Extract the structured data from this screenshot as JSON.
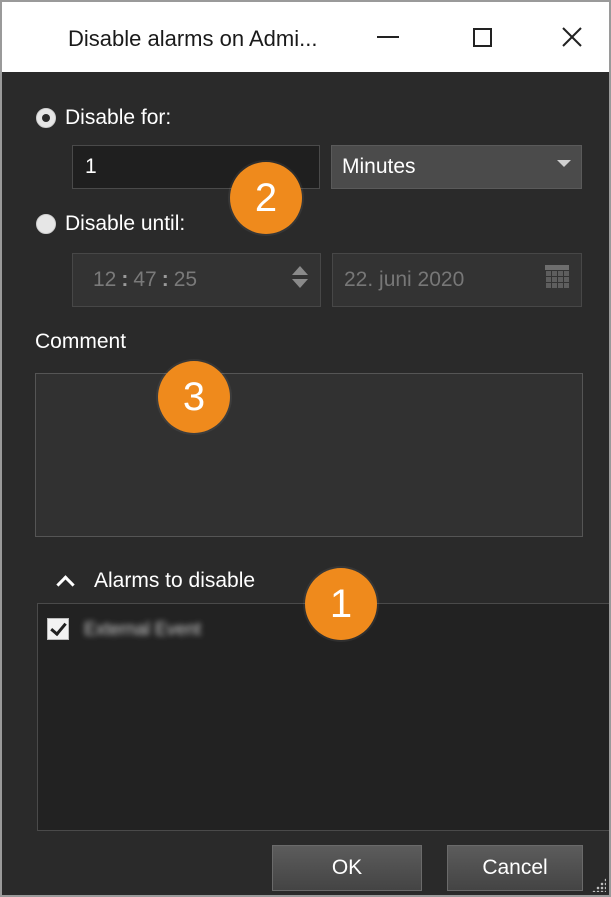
{
  "window": {
    "title": "Disable alarms on Admi...",
    "controls": {
      "minimize": "minimize",
      "maximize": "maximize",
      "close": "close"
    }
  },
  "disable_for": {
    "label": "Disable for:",
    "selected": true,
    "value": "1",
    "unit": "Minutes"
  },
  "disable_until": {
    "label": "Disable until:",
    "selected": false,
    "time": {
      "hours": "12",
      "minutes": "47",
      "seconds": "25",
      "separator": ":"
    },
    "date": "22. juni 2020"
  },
  "comment": {
    "label": "Comment",
    "value": ""
  },
  "alarms_section": {
    "label": "Alarms to disable",
    "expanded": true,
    "items": [
      {
        "name": "External Event",
        "checked": true
      }
    ]
  },
  "buttons": {
    "ok": "OK",
    "cancel": "Cancel"
  },
  "callouts": [
    "1",
    "2",
    "3"
  ],
  "colors": {
    "dialog_bg": "#2a2a2a",
    "badge": "#ef8a1c",
    "title_bar": "#ffffff"
  }
}
